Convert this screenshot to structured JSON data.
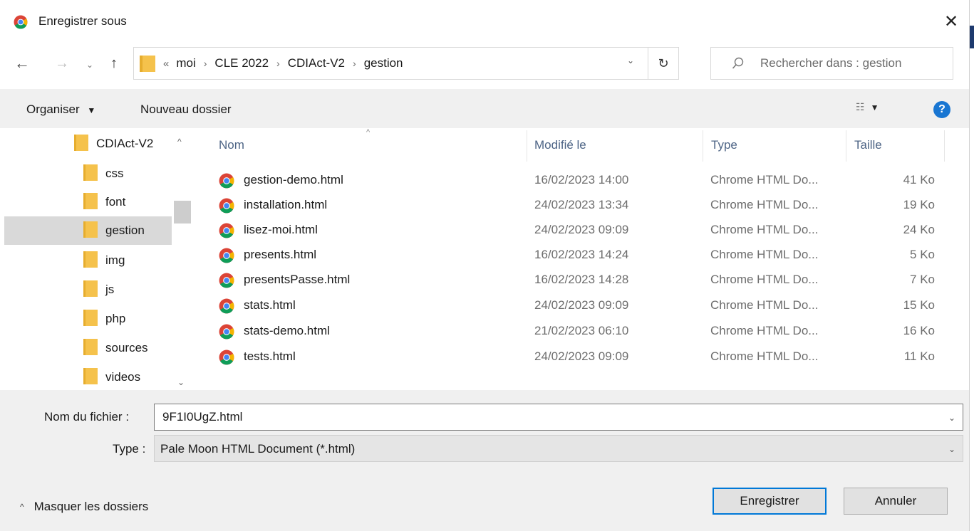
{
  "window": {
    "title": "Enregistrer sous",
    "close_glyph": "✕",
    "app_icon": "chrome-icon"
  },
  "navigation": {
    "back_glyph": "←",
    "forward_glyph": "→",
    "recent_glyph": "⌄",
    "up_glyph": "↑",
    "more_glyph": "«",
    "breadcrumbs": [
      "moi",
      "CLE 2022",
      "CDIAct-V2",
      "gestion"
    ],
    "separator": "›",
    "dropdown_glyph": "⌄",
    "refresh_glyph": "↻",
    "search_placeholder": "Rechercher dans : gestion"
  },
  "toolbar": {
    "organize_label": "Organiser",
    "organize_caret": "▼",
    "new_folder_label": "Nouveau dossier",
    "view_glyph": "☷",
    "view_caret": "▼",
    "help_glyph": "?"
  },
  "tree": {
    "items": [
      {
        "label": "CDIAct-V2",
        "selected": false
      },
      {
        "label": "css",
        "selected": false
      },
      {
        "label": "font",
        "selected": false
      },
      {
        "label": "gestion",
        "selected": true
      },
      {
        "label": "img",
        "selected": false
      },
      {
        "label": "js",
        "selected": false
      },
      {
        "label": "php",
        "selected": false
      },
      {
        "label": "sources",
        "selected": false
      },
      {
        "label": "videos",
        "selected": false
      }
    ],
    "scroll_up_glyph": "^",
    "scroll_down_glyph": "⌄"
  },
  "file_list": {
    "sort_glyph": "^",
    "columns": [
      "Nom",
      "Modifié le",
      "Type",
      "Taille"
    ],
    "rows": [
      {
        "name": "gestion-demo.html",
        "modified": "16/02/2023 14:00",
        "type": "Chrome HTML Do...",
        "size": "41 Ko"
      },
      {
        "name": "installation.html",
        "modified": "24/02/2023 13:34",
        "type": "Chrome HTML Do...",
        "size": "19 Ko"
      },
      {
        "name": "lisez-moi.html",
        "modified": "24/02/2023 09:09",
        "type": "Chrome HTML Do...",
        "size": "24 Ko"
      },
      {
        "name": "presents.html",
        "modified": "16/02/2023 14:24",
        "type": "Chrome HTML Do...",
        "size": "5 Ko"
      },
      {
        "name": "presentsPasse.html",
        "modified": "16/02/2023 14:28",
        "type": "Chrome HTML Do...",
        "size": "7 Ko"
      },
      {
        "name": "stats.html",
        "modified": "24/02/2023 09:09",
        "type": "Chrome HTML Do...",
        "size": "15 Ko"
      },
      {
        "name": "stats-demo.html",
        "modified": "21/02/2023 06:10",
        "type": "Chrome HTML Do...",
        "size": "16 Ko"
      },
      {
        "name": "tests.html",
        "modified": "24/02/2023 09:09",
        "type": "Chrome HTML Do...",
        "size": "11 Ko"
      }
    ]
  },
  "form": {
    "filename_label": "Nom du fichier :",
    "filename_value": "9F1I0UgZ.html",
    "type_label": "Type :",
    "type_value": "Pale Moon HTML Document (*.html)",
    "caret_glyph": "⌄"
  },
  "footer": {
    "hide_folders_glyph": "^",
    "hide_folders_label": "Masquer les dossiers",
    "save_label": "Enregistrer",
    "cancel_label": "Annuler"
  },
  "colors": {
    "accent": "#0078d7",
    "folder": "#f5c24c",
    "help": "#1976d2",
    "chrome_red": "#db4437",
    "chrome_yellow": "#f4b400",
    "chrome_green": "#0f9d58",
    "chrome_blue": "#4285f4"
  }
}
